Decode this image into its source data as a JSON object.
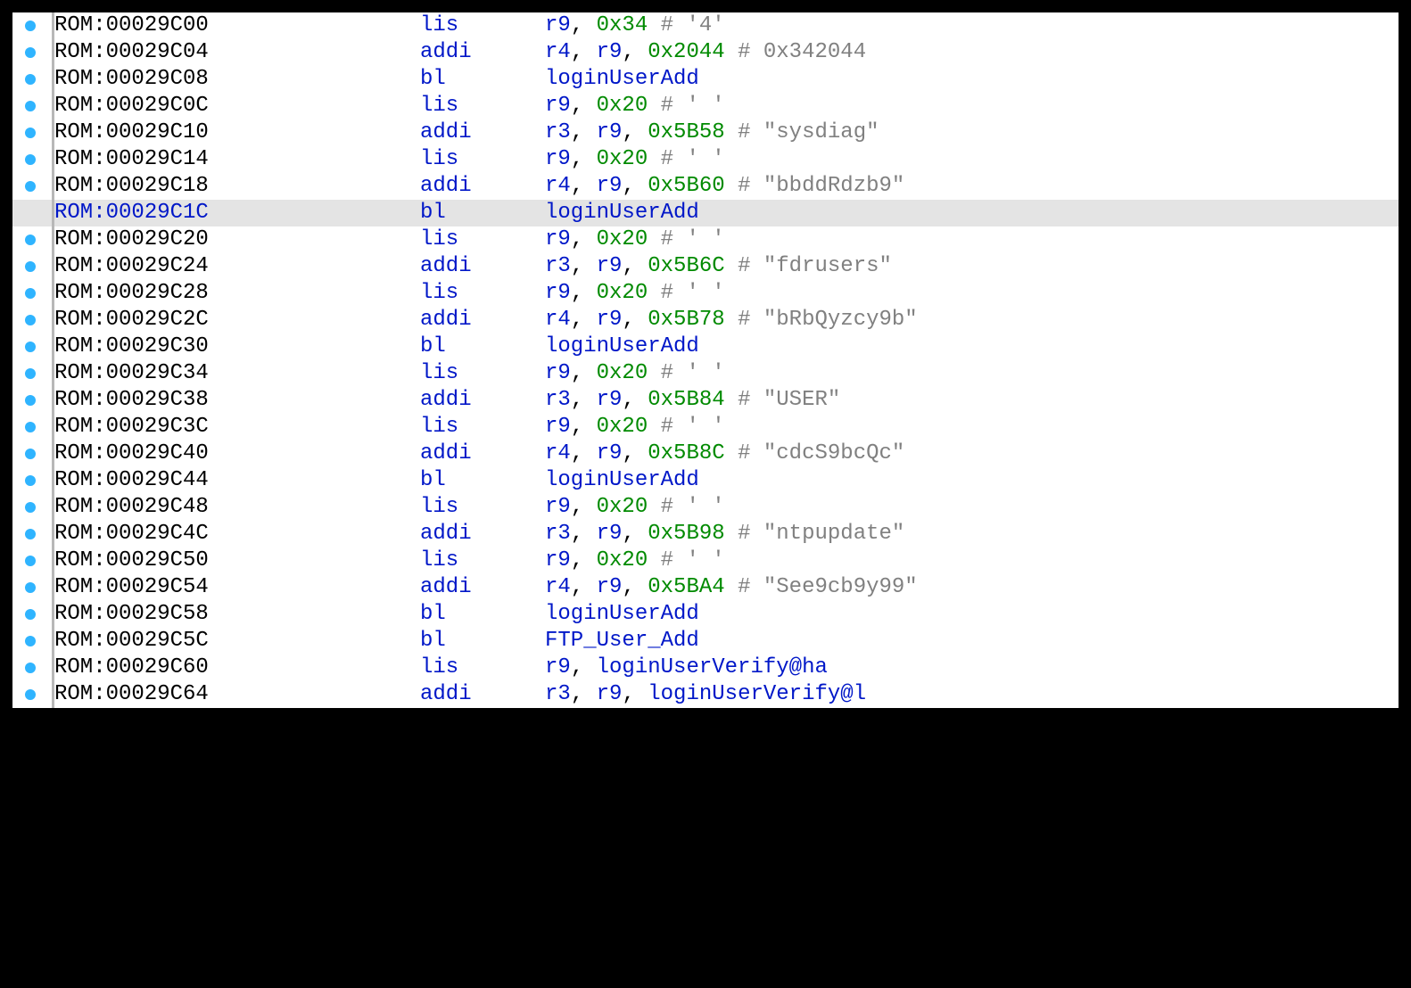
{
  "rows": [
    {
      "addr": "ROM:00029C00",
      "mn": "lis",
      "ops": [
        {
          "t": "reg",
          "v": "r9"
        },
        {
          "t": "pun",
          "v": ", "
        },
        {
          "t": "num",
          "v": "0x34"
        },
        {
          "t": "cmt",
          "v": " # '4'"
        }
      ],
      "bp": true,
      "hl": false
    },
    {
      "addr": "ROM:00029C04",
      "mn": "addi",
      "ops": [
        {
          "t": "reg",
          "v": "r4"
        },
        {
          "t": "pun",
          "v": ", "
        },
        {
          "t": "reg",
          "v": "r9"
        },
        {
          "t": "pun",
          "v": ", "
        },
        {
          "t": "num",
          "v": "0x2044"
        },
        {
          "t": "cmt",
          "v": " # 0x342044"
        }
      ],
      "bp": true,
      "hl": false
    },
    {
      "addr": "ROM:00029C08",
      "mn": "bl",
      "ops": [
        {
          "t": "sym",
          "v": "loginUserAdd"
        }
      ],
      "bp": true,
      "hl": false
    },
    {
      "addr": "ROM:00029C0C",
      "mn": "lis",
      "ops": [
        {
          "t": "reg",
          "v": "r9"
        },
        {
          "t": "pun",
          "v": ", "
        },
        {
          "t": "num",
          "v": "0x20"
        },
        {
          "t": "cmt",
          "v": " # ' '"
        }
      ],
      "bp": true,
      "hl": false
    },
    {
      "addr": "ROM:00029C10",
      "mn": "addi",
      "ops": [
        {
          "t": "reg",
          "v": "r3"
        },
        {
          "t": "pun",
          "v": ", "
        },
        {
          "t": "reg",
          "v": "r9"
        },
        {
          "t": "pun",
          "v": ", "
        },
        {
          "t": "num",
          "v": "0x5B58"
        },
        {
          "t": "cmt",
          "v": " # \"sysdiag\""
        }
      ],
      "bp": true,
      "hl": false
    },
    {
      "addr": "ROM:00029C14",
      "mn": "lis",
      "ops": [
        {
          "t": "reg",
          "v": "r9"
        },
        {
          "t": "pun",
          "v": ", "
        },
        {
          "t": "num",
          "v": "0x20"
        },
        {
          "t": "cmt",
          "v": " # ' '"
        }
      ],
      "bp": true,
      "hl": false
    },
    {
      "addr": "ROM:00029C18",
      "mn": "addi",
      "ops": [
        {
          "t": "reg",
          "v": "r4"
        },
        {
          "t": "pun",
          "v": ", "
        },
        {
          "t": "reg",
          "v": "r9"
        },
        {
          "t": "pun",
          "v": ", "
        },
        {
          "t": "num",
          "v": "0x5B60"
        },
        {
          "t": "cmt",
          "v": " # \"bbddRdzb9\""
        }
      ],
      "bp": true,
      "hl": false
    },
    {
      "addr": "ROM:00029C1C",
      "mn": "bl",
      "ops": [
        {
          "t": "sym",
          "v": "loginUserAdd"
        }
      ],
      "bp": false,
      "hl": true
    },
    {
      "addr": "ROM:00029C20",
      "mn": "lis",
      "ops": [
        {
          "t": "reg",
          "v": "r9"
        },
        {
          "t": "pun",
          "v": ", "
        },
        {
          "t": "num",
          "v": "0x20"
        },
        {
          "t": "cmt",
          "v": " # ' '"
        }
      ],
      "bp": true,
      "hl": false
    },
    {
      "addr": "ROM:00029C24",
      "mn": "addi",
      "ops": [
        {
          "t": "reg",
          "v": "r3"
        },
        {
          "t": "pun",
          "v": ", "
        },
        {
          "t": "reg",
          "v": "r9"
        },
        {
          "t": "pun",
          "v": ", "
        },
        {
          "t": "num",
          "v": "0x5B6C"
        },
        {
          "t": "cmt",
          "v": " # \"fdrusers\""
        }
      ],
      "bp": true,
      "hl": false
    },
    {
      "addr": "ROM:00029C28",
      "mn": "lis",
      "ops": [
        {
          "t": "reg",
          "v": "r9"
        },
        {
          "t": "pun",
          "v": ", "
        },
        {
          "t": "num",
          "v": "0x20"
        },
        {
          "t": "cmt",
          "v": " # ' '"
        }
      ],
      "bp": true,
      "hl": false
    },
    {
      "addr": "ROM:00029C2C",
      "mn": "addi",
      "ops": [
        {
          "t": "reg",
          "v": "r4"
        },
        {
          "t": "pun",
          "v": ", "
        },
        {
          "t": "reg",
          "v": "r9"
        },
        {
          "t": "pun",
          "v": ", "
        },
        {
          "t": "num",
          "v": "0x5B78"
        },
        {
          "t": "cmt",
          "v": " # \"bRbQyzcy9b\""
        }
      ],
      "bp": true,
      "hl": false
    },
    {
      "addr": "ROM:00029C30",
      "mn": "bl",
      "ops": [
        {
          "t": "sym",
          "v": "loginUserAdd"
        }
      ],
      "bp": true,
      "hl": false
    },
    {
      "addr": "ROM:00029C34",
      "mn": "lis",
      "ops": [
        {
          "t": "reg",
          "v": "r9"
        },
        {
          "t": "pun",
          "v": ", "
        },
        {
          "t": "num",
          "v": "0x20"
        },
        {
          "t": "cmt",
          "v": " # ' '"
        }
      ],
      "bp": true,
      "hl": false
    },
    {
      "addr": "ROM:00029C38",
      "mn": "addi",
      "ops": [
        {
          "t": "reg",
          "v": "r3"
        },
        {
          "t": "pun",
          "v": ", "
        },
        {
          "t": "reg",
          "v": "r9"
        },
        {
          "t": "pun",
          "v": ", "
        },
        {
          "t": "num",
          "v": "0x5B84"
        },
        {
          "t": "cmt",
          "v": " # \"USER\""
        }
      ],
      "bp": true,
      "hl": false
    },
    {
      "addr": "ROM:00029C3C",
      "mn": "lis",
      "ops": [
        {
          "t": "reg",
          "v": "r9"
        },
        {
          "t": "pun",
          "v": ", "
        },
        {
          "t": "num",
          "v": "0x20"
        },
        {
          "t": "cmt",
          "v": " # ' '"
        }
      ],
      "bp": true,
      "hl": false
    },
    {
      "addr": "ROM:00029C40",
      "mn": "addi",
      "ops": [
        {
          "t": "reg",
          "v": "r4"
        },
        {
          "t": "pun",
          "v": ", "
        },
        {
          "t": "reg",
          "v": "r9"
        },
        {
          "t": "pun",
          "v": ", "
        },
        {
          "t": "num",
          "v": "0x5B8C"
        },
        {
          "t": "cmt",
          "v": " # \"cdcS9bcQc\""
        }
      ],
      "bp": true,
      "hl": false
    },
    {
      "addr": "ROM:00029C44",
      "mn": "bl",
      "ops": [
        {
          "t": "sym",
          "v": "loginUserAdd"
        }
      ],
      "bp": true,
      "hl": false
    },
    {
      "addr": "ROM:00029C48",
      "mn": "lis",
      "ops": [
        {
          "t": "reg",
          "v": "r9"
        },
        {
          "t": "pun",
          "v": ", "
        },
        {
          "t": "num",
          "v": "0x20"
        },
        {
          "t": "cmt",
          "v": " # ' '"
        }
      ],
      "bp": true,
      "hl": false
    },
    {
      "addr": "ROM:00029C4C",
      "mn": "addi",
      "ops": [
        {
          "t": "reg",
          "v": "r3"
        },
        {
          "t": "pun",
          "v": ", "
        },
        {
          "t": "reg",
          "v": "r9"
        },
        {
          "t": "pun",
          "v": ", "
        },
        {
          "t": "num",
          "v": "0x5B98"
        },
        {
          "t": "cmt",
          "v": " # \"ntpupdate\""
        }
      ],
      "bp": true,
      "hl": false
    },
    {
      "addr": "ROM:00029C50",
      "mn": "lis",
      "ops": [
        {
          "t": "reg",
          "v": "r9"
        },
        {
          "t": "pun",
          "v": ", "
        },
        {
          "t": "num",
          "v": "0x20"
        },
        {
          "t": "cmt",
          "v": " # ' '"
        }
      ],
      "bp": true,
      "hl": false
    },
    {
      "addr": "ROM:00029C54",
      "mn": "addi",
      "ops": [
        {
          "t": "reg",
          "v": "r4"
        },
        {
          "t": "pun",
          "v": ", "
        },
        {
          "t": "reg",
          "v": "r9"
        },
        {
          "t": "pun",
          "v": ", "
        },
        {
          "t": "num",
          "v": "0x5BA4"
        },
        {
          "t": "cmt",
          "v": " # \"See9cb9y99\""
        }
      ],
      "bp": true,
      "hl": false
    },
    {
      "addr": "ROM:00029C58",
      "mn": "bl",
      "ops": [
        {
          "t": "sym",
          "v": "loginUserAdd"
        }
      ],
      "bp": true,
      "hl": false
    },
    {
      "addr": "ROM:00029C5C",
      "mn": "bl",
      "ops": [
        {
          "t": "sym",
          "v": "FTP_User_Add"
        }
      ],
      "bp": true,
      "hl": false
    },
    {
      "addr": "ROM:00029C60",
      "mn": "lis",
      "ops": [
        {
          "t": "reg",
          "v": "r9"
        },
        {
          "t": "pun",
          "v": ", "
        },
        {
          "t": "sym",
          "v": "loginUserVerify"
        },
        {
          "t": "reg",
          "v": "@ha"
        }
      ],
      "bp": true,
      "hl": false
    },
    {
      "addr": "ROM:00029C64",
      "mn": "addi",
      "ops": [
        {
          "t": "reg",
          "v": "r3"
        },
        {
          "t": "pun",
          "v": ", "
        },
        {
          "t": "reg",
          "v": "r9"
        },
        {
          "t": "pun",
          "v": ", "
        },
        {
          "t": "sym",
          "v": "loginUserVerify"
        },
        {
          "t": "reg",
          "v": "@l"
        }
      ],
      "bp": true,
      "hl": false
    }
  ]
}
